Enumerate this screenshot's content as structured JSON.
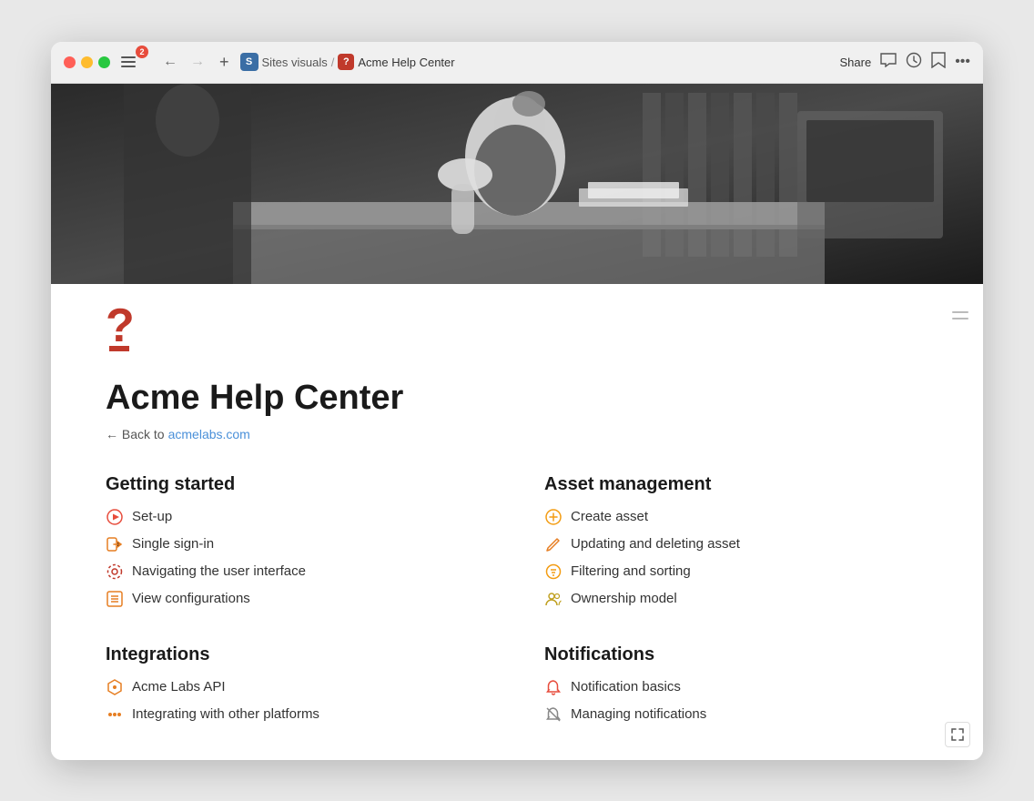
{
  "browser": {
    "badge": "2",
    "breadcrumbs": [
      "Sites visuals",
      "Acme Help Center"
    ],
    "share_label": "Share",
    "nav": {
      "back_icon": "←",
      "forward_icon": "→",
      "sidebar_icon": "≡",
      "add_icon": "+"
    }
  },
  "hero": {
    "alt": "Black and white photo of a woman working at a desk"
  },
  "logo": {
    "question_mark": "?",
    "icon_label": "?"
  },
  "page": {
    "title": "Acme Help Center",
    "back_text": "← Back to",
    "back_link_label": "acmelabs.com",
    "back_link_url": "https://acmelabs.com"
  },
  "sections": [
    {
      "id": "getting-started",
      "title": "Getting started",
      "links": [
        {
          "icon": "▶",
          "icon_color": "#e74c3c",
          "label": "Set-up"
        },
        {
          "icon": "⮐",
          "icon_color": "#e67e22",
          "label": "Single sign-in"
        },
        {
          "icon": "⚙",
          "icon_color": "#c0392b",
          "label": "Navigating the user interface"
        },
        {
          "icon": "☰",
          "icon_color": "#e67e22",
          "label": "View configurations"
        }
      ]
    },
    {
      "id": "asset-management",
      "title": "Asset management",
      "links": [
        {
          "icon": "⊕",
          "icon_color": "#f39c12",
          "label": "Create asset"
        },
        {
          "icon": "✏",
          "icon_color": "#e67e22",
          "label": "Updating and deleting asset"
        },
        {
          "icon": "⊜",
          "icon_color": "#f39c12",
          "label": "Filtering and sorting"
        },
        {
          "icon": "👥",
          "icon_color": "#c0a020",
          "label": "Ownership model"
        }
      ]
    },
    {
      "id": "integrations",
      "title": "Integrations",
      "links": [
        {
          "icon": "⬡",
          "icon_color": "#e67e22",
          "label": "Acme Labs API"
        },
        {
          "icon": "···",
          "icon_color": "#e67e22",
          "label": "Integrating with other platforms"
        }
      ]
    },
    {
      "id": "notifications",
      "title": "Notifications",
      "links": [
        {
          "icon": "🔔",
          "icon_color": "#e74c3c",
          "label": "Notification basics"
        },
        {
          "icon": "🔕",
          "icon_color": "#888",
          "label": "Managing notifications"
        }
      ]
    }
  ]
}
